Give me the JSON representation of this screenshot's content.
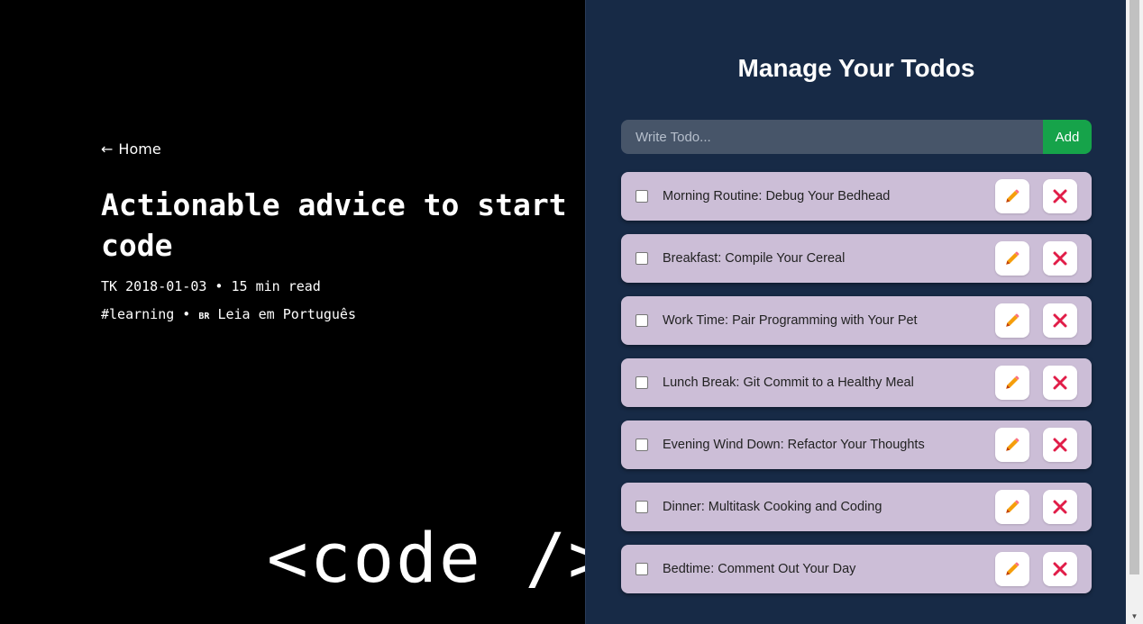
{
  "article": {
    "home_link": "Home",
    "title": "Actionable advice to start code",
    "meta_line": "TK 2018-01-03 • 15 min read",
    "tag": "#learning • ",
    "flag": "BR",
    "translation": " Leia em Português",
    "hero_code": "<code />"
  },
  "todo_panel": {
    "title": "Manage Your Todos",
    "input_placeholder": "Write Todo...",
    "add_label": "Add",
    "items": [
      {
        "text": "Morning Routine: Debug Your Bedhead",
        "checked": false
      },
      {
        "text": "Breakfast: Compile Your Cereal",
        "checked": false
      },
      {
        "text": "Work Time: Pair Programming with Your Pet",
        "checked": false
      },
      {
        "text": "Lunch Break: Git Commit to a Healthy Meal",
        "checked": false
      },
      {
        "text": "Evening Wind Down: Refactor Your Thoughts",
        "checked": false
      },
      {
        "text": "Dinner: Multitask Cooking and Coding",
        "checked": false
      },
      {
        "text": "Bedtime: Comment Out Your Day",
        "checked": false
      }
    ],
    "edit_icon": "pencil-icon",
    "delete_icon": "close-icon"
  },
  "colors": {
    "panel_bg": "#172a46",
    "input_bg": "#475569",
    "add_button": "#16a34a",
    "todo_bg": "#ccbed7",
    "pencil": "#f59e0b",
    "delete_x": "#e11d48"
  }
}
